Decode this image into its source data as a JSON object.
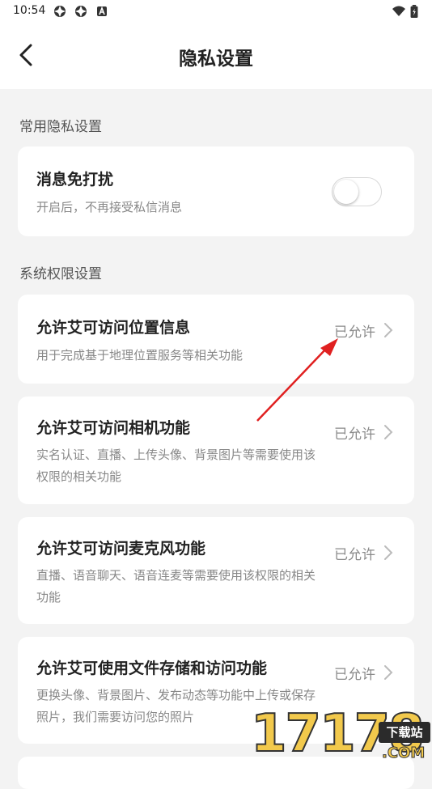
{
  "status_bar": {
    "time": "10:54"
  },
  "header": {
    "title": "隐私设置"
  },
  "sections": [
    {
      "title": "常用隐私设置"
    },
    {
      "title": "系统权限设置"
    }
  ],
  "dnd": {
    "title": "消息免打扰",
    "desc": "开启后，不再接受私信消息",
    "enabled": false
  },
  "permissions": [
    {
      "title": "允许艾可访问位置信息",
      "desc": "用于完成基于地理位置服务等相关功能",
      "status": "已允许"
    },
    {
      "title": "允许艾可访问相机功能",
      "desc": "实名认证、直播、上传头像、背景图片等需要使用该权限的相关功能",
      "status": "已允许"
    },
    {
      "title": "允许艾可访问麦克风功能",
      "desc": "直播、语音聊天、语音连麦等需要使用该权限的相关功能",
      "status": "已允许"
    },
    {
      "title": "允许艾可使用文件存储和访问功能",
      "desc": "更换头像、背景图片、发布动态等功能中上传或保存照片，我们需要访问您的照片",
      "status": "已允许"
    }
  ],
  "watermark": {
    "number": "17178",
    "badge": "下载站",
    "suffix": ".COM"
  },
  "colors": {
    "background": "#f3f3f3",
    "card": "#ffffff",
    "annotation_arrow": "#e02020",
    "watermark": "#f2c94c"
  }
}
